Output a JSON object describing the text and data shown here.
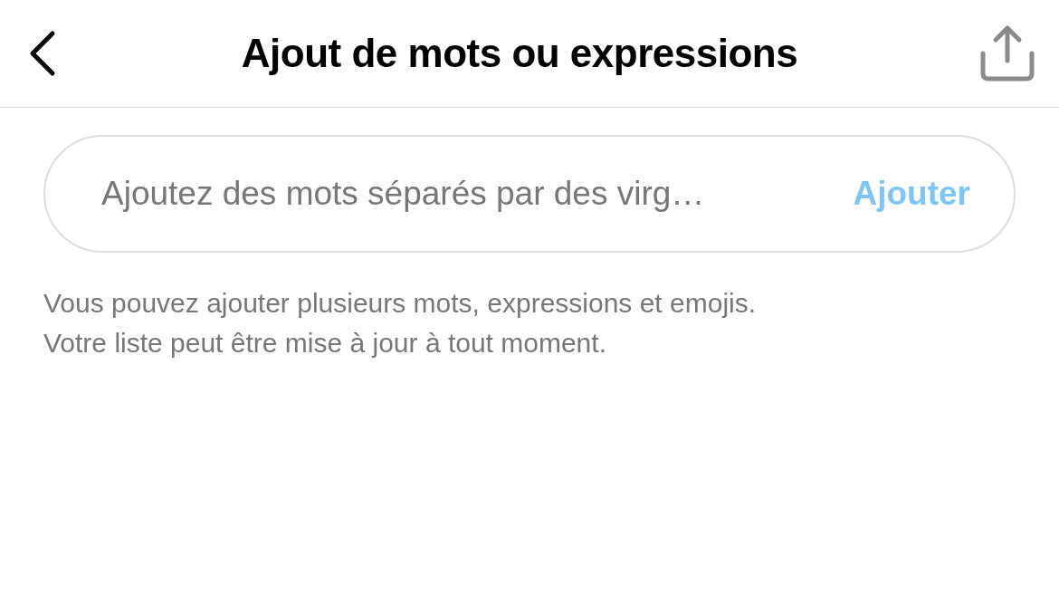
{
  "header": {
    "title": "Ajout de mots ou expressions"
  },
  "field": {
    "placeholder": "Ajoutez des mots séparés par des virg…",
    "button": "Ajouter"
  },
  "help": [
    "Vous pouvez ajouter plusieurs mots, expressions et emojis.",
    "Votre liste peut être mise à jour à tout moment."
  ]
}
